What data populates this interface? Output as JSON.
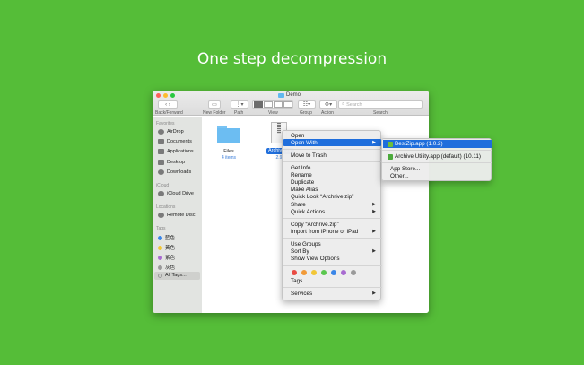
{
  "headline": "One step decompression",
  "window": {
    "title": "Demo",
    "toolbar": {
      "back_forward": "Back/Forward",
      "new_folder": "New Folder",
      "path": "Path",
      "view": "View",
      "group": "Group",
      "action": "Action",
      "search_label": "Search",
      "search_placeholder": "Search"
    },
    "sidebar": {
      "favorites_header": "Favorites",
      "favorites": [
        "AirDrop",
        "Documents",
        "Applications",
        "Desktop",
        "Downloads"
      ],
      "icloud_header": "iCloud",
      "icloud": [
        "iCloud Drive"
      ],
      "locations_header": "Locations",
      "locations": [
        "Remote Disc"
      ],
      "tags_header": "Tags",
      "tags": [
        {
          "label": "藍色",
          "color": "#3a86e8"
        },
        {
          "label": "黃色",
          "color": "#f2c636"
        },
        {
          "label": "紫色",
          "color": "#a86bd0"
        },
        {
          "label": "灰色",
          "color": "#9a9a9a"
        }
      ],
      "all_tags": "All Tags..."
    },
    "files": [
      {
        "name": "Files",
        "sub": "4 items"
      },
      {
        "name": "Archive.zip",
        "sub": "2.9"
      }
    ]
  },
  "context_menu": {
    "open": "Open",
    "open_with": "Open With",
    "move_to_trash": "Move to Trash",
    "get_info": "Get Info",
    "rename": "Rename",
    "duplicate": "Duplicate",
    "make_alias": "Make Alias",
    "quick_look": "Quick Look “Archrive.zip”",
    "share": "Share",
    "quick_actions": "Quick Actions",
    "copy": "Copy “Archrive.zip”",
    "import": "Import from iPhone or iPad",
    "use_groups": "Use Groups",
    "sort_by": "Sort By",
    "show_view_options": "Show View Options",
    "tags": "Tags...",
    "services": "Services",
    "tag_colors": [
      "#e94b43",
      "#f19a38",
      "#f2c636",
      "#5ac74e",
      "#3a86e8",
      "#a86bd0",
      "#9a9a9a"
    ]
  },
  "submenu": {
    "bestzip": "BestZip.app (1.0.2)",
    "archive_utility": "Archive Utility.app (default) (10.11)",
    "app_store": "App Store...",
    "other": "Other..."
  }
}
